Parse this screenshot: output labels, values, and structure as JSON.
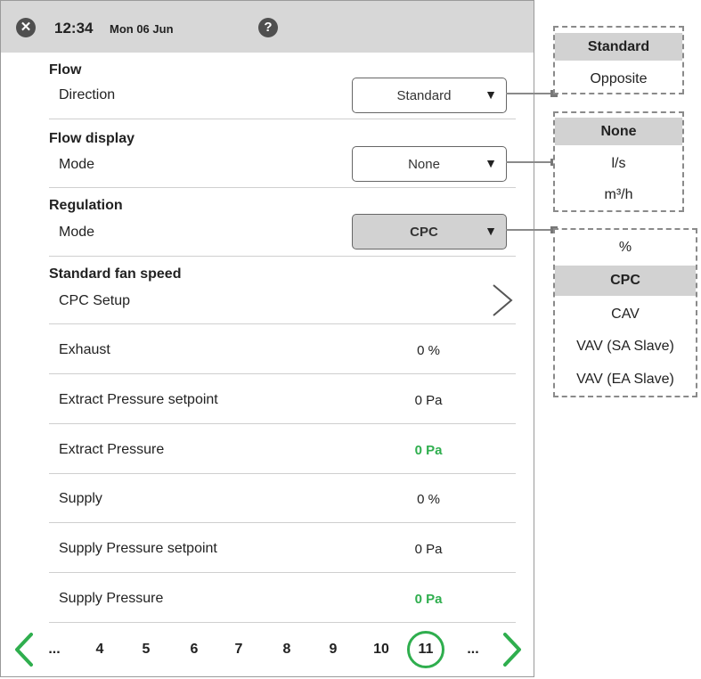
{
  "header": {
    "time": "12:34",
    "date": "Mon 06 Jun",
    "close_icon": "close-icon",
    "help_icon": "help-icon",
    "help_glyph": "?",
    "close_glyph": "✕"
  },
  "flow": {
    "title": "Flow",
    "label": "Direction",
    "value": "Standard"
  },
  "flow_display": {
    "title": "Flow display",
    "label": "Mode",
    "value": "None"
  },
  "regulation": {
    "title": "Regulation",
    "label": "Mode",
    "value": "CPC"
  },
  "fan": {
    "title": "Standard fan speed",
    "label": "CPC Setup"
  },
  "rows": [
    {
      "label": "Exhaust",
      "value": "0 %"
    },
    {
      "label": "Extract Pressure setpoint",
      "value": "0 Pa"
    },
    {
      "label": "Extract Pressure",
      "value": "0 Pa"
    },
    {
      "label": "Supply",
      "value": "0 %"
    },
    {
      "label": "Supply Pressure setpoint",
      "value": "0 Pa"
    },
    {
      "label": "Supply Pressure",
      "value": "0 Pa"
    }
  ],
  "pager": {
    "pages": [
      "...",
      "4",
      "5",
      "6",
      "7",
      "8",
      "9",
      "10",
      "11",
      "..."
    ],
    "current": "11"
  },
  "popups": {
    "flow": [
      "Standard",
      "Opposite"
    ],
    "flow_display": [
      "None",
      "l/s",
      "m³/h"
    ],
    "regulation": [
      "%",
      "CPC",
      "CAV",
      "VAV (SA Slave)",
      "VAV (EA Slave)"
    ]
  },
  "arrow_glyph": "▼",
  "colors": {
    "accent_green": "#2fae4e",
    "header_bg": "#d7d7d7",
    "selected_bg": "#d2d2d2"
  }
}
